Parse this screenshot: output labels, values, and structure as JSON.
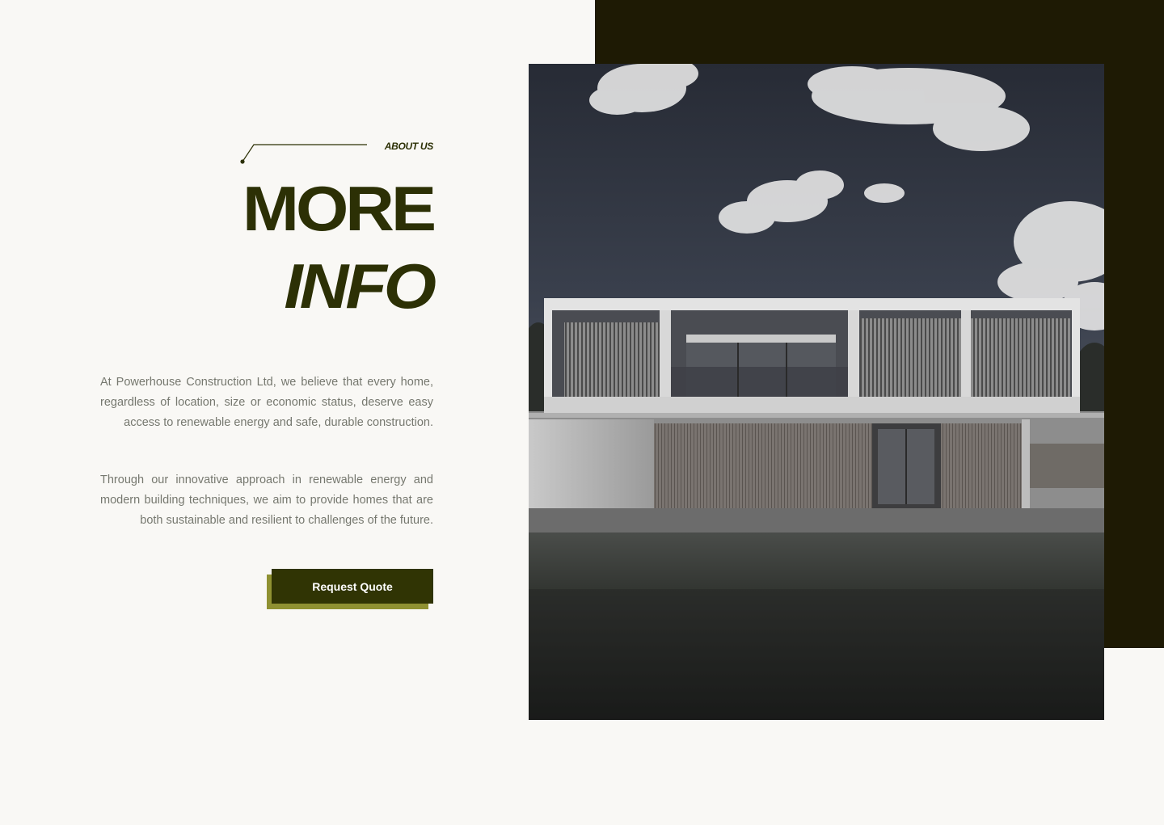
{
  "about": {
    "eyebrow": "ABOUT US",
    "title_line1": "MORE",
    "title_line2": "INFO"
  },
  "body": {
    "paragraph1": "At Powerhouse Construction Ltd, we believe that every home, regardless of location, size or economic status, deserve easy access to renewable energy and safe, durable  construction.",
    "paragraph2": "Through  our innovative approach in  renewable energy  and modern building techniques,  we aim to  provide homes that are both sustainable and resilient to challenges of the future."
  },
  "cta": {
    "label": "Request  Quote"
  },
  "colors": {
    "accent": "#2c3005",
    "dark_panel": "#1e1a04",
    "button_shadow": "#8f9132",
    "background": "#f9f8f5"
  },
  "image": {
    "subject": "modern-house-photo"
  }
}
